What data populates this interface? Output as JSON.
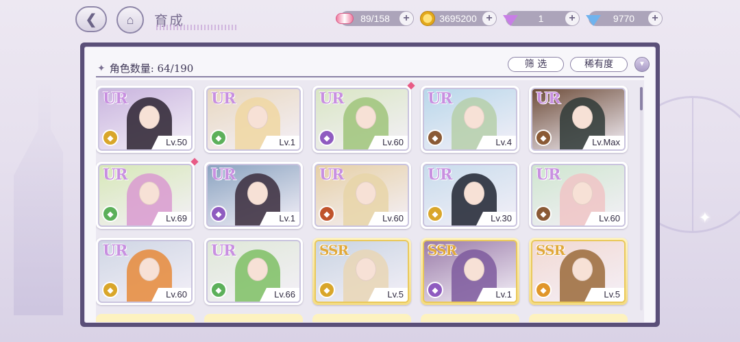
{
  "header": {
    "back_icon": "back-arrow-icon",
    "home_icon": "home-icon",
    "title": "育成"
  },
  "resources": [
    {
      "id": "stamina",
      "icon": "candy-icon",
      "value": "89/158"
    },
    {
      "id": "gold",
      "icon": "coin-icon",
      "value": "3695200"
    },
    {
      "id": "paid-gem",
      "icon": "purple-diamond-icon",
      "value": "1"
    },
    {
      "id": "free-gem",
      "icon": "blue-diamond-icon",
      "value": "9770"
    }
  ],
  "list": {
    "count_label": "角色数量: 64/190",
    "filter_label": "筛 选",
    "rarity_label": "稀有度",
    "sort_icon": "sort-order-icon"
  },
  "cards": [
    {
      "rarity": "UR",
      "level": "Lv.50",
      "attr_color": "#d9a62a",
      "bg": "#c9b4de",
      "hair": "#2b2230",
      "new": false
    },
    {
      "rarity": "UR",
      "level": "Lv.1",
      "attr_color": "#5cb05a",
      "bg": "#e8d8c0",
      "hair": "#f0d7a2",
      "new": false
    },
    {
      "rarity": "UR",
      "level": "Lv.60",
      "attr_color": "#8f5bc0",
      "bg": "#d9e6c4",
      "hair": "#9fc47a",
      "new": true
    },
    {
      "rarity": "UR",
      "level": "Lv.4",
      "attr_color": "#8a5a35",
      "bg": "#b8d7ea",
      "hair": "#b6cfa9",
      "new": false
    },
    {
      "rarity": "UR",
      "level": "Lv.Max",
      "attr_color": "#8a5a35",
      "bg": "#6e4d3a",
      "hair": "#2f3a37",
      "new": false
    },
    {
      "rarity": "UR",
      "level": "Lv.69",
      "attr_color": "#5cb05a",
      "bg": "#d7e8b8",
      "hair": "#d99ad0",
      "new": true
    },
    {
      "rarity": "UR",
      "level": "Lv.1",
      "attr_color": "#8f5bc0",
      "bg": "#8aa3c0",
      "hair": "#3a2c3c",
      "new": false
    },
    {
      "rarity": "UR",
      "level": "Lv.60",
      "attr_color": "#c0532b",
      "bg": "#e6d0a6",
      "hair": "#e8d5a8",
      "new": false
    },
    {
      "rarity": "UR",
      "level": "Lv.30",
      "attr_color": "#d9a62a",
      "bg": "#c8dcec",
      "hair": "#1f2330",
      "new": false
    },
    {
      "rarity": "UR",
      "level": "Lv.60",
      "attr_color": "#8a5a35",
      "bg": "#cfe6cf",
      "hair": "#f0c4c6",
      "new": false
    },
    {
      "rarity": "UR",
      "level": "Lv.60",
      "attr_color": "#d9a62a",
      "bg": "#cfd6e4",
      "hair": "#e68a3a",
      "new": false
    },
    {
      "rarity": "UR",
      "level": "Lv.66",
      "attr_color": "#5cb05a",
      "bg": "#dfe8d8",
      "hair": "#7ec064",
      "new": false
    },
    {
      "rarity": "SSR",
      "level": "Lv.5",
      "attr_color": "#d9a62a",
      "bg": "#c9d4e2",
      "hair": "#e9d6b5",
      "new": false
    },
    {
      "rarity": "SSR",
      "level": "Lv.1",
      "attr_color": "#8f5bc0",
      "bg": "#9a7ba8",
      "hair": "#7e5b9e",
      "new": false
    },
    {
      "rarity": "SSR",
      "level": "Lv.5",
      "attr_color": "#e0962a",
      "bg": "#f2d9d2",
      "hair": "#9a6a3a",
      "new": false
    }
  ],
  "peek_rarity_colors": [
    "#fdf2c0",
    "#fdf2c0",
    "#fdf2c0",
    "#fdf2c0",
    "#fdf2c0"
  ]
}
